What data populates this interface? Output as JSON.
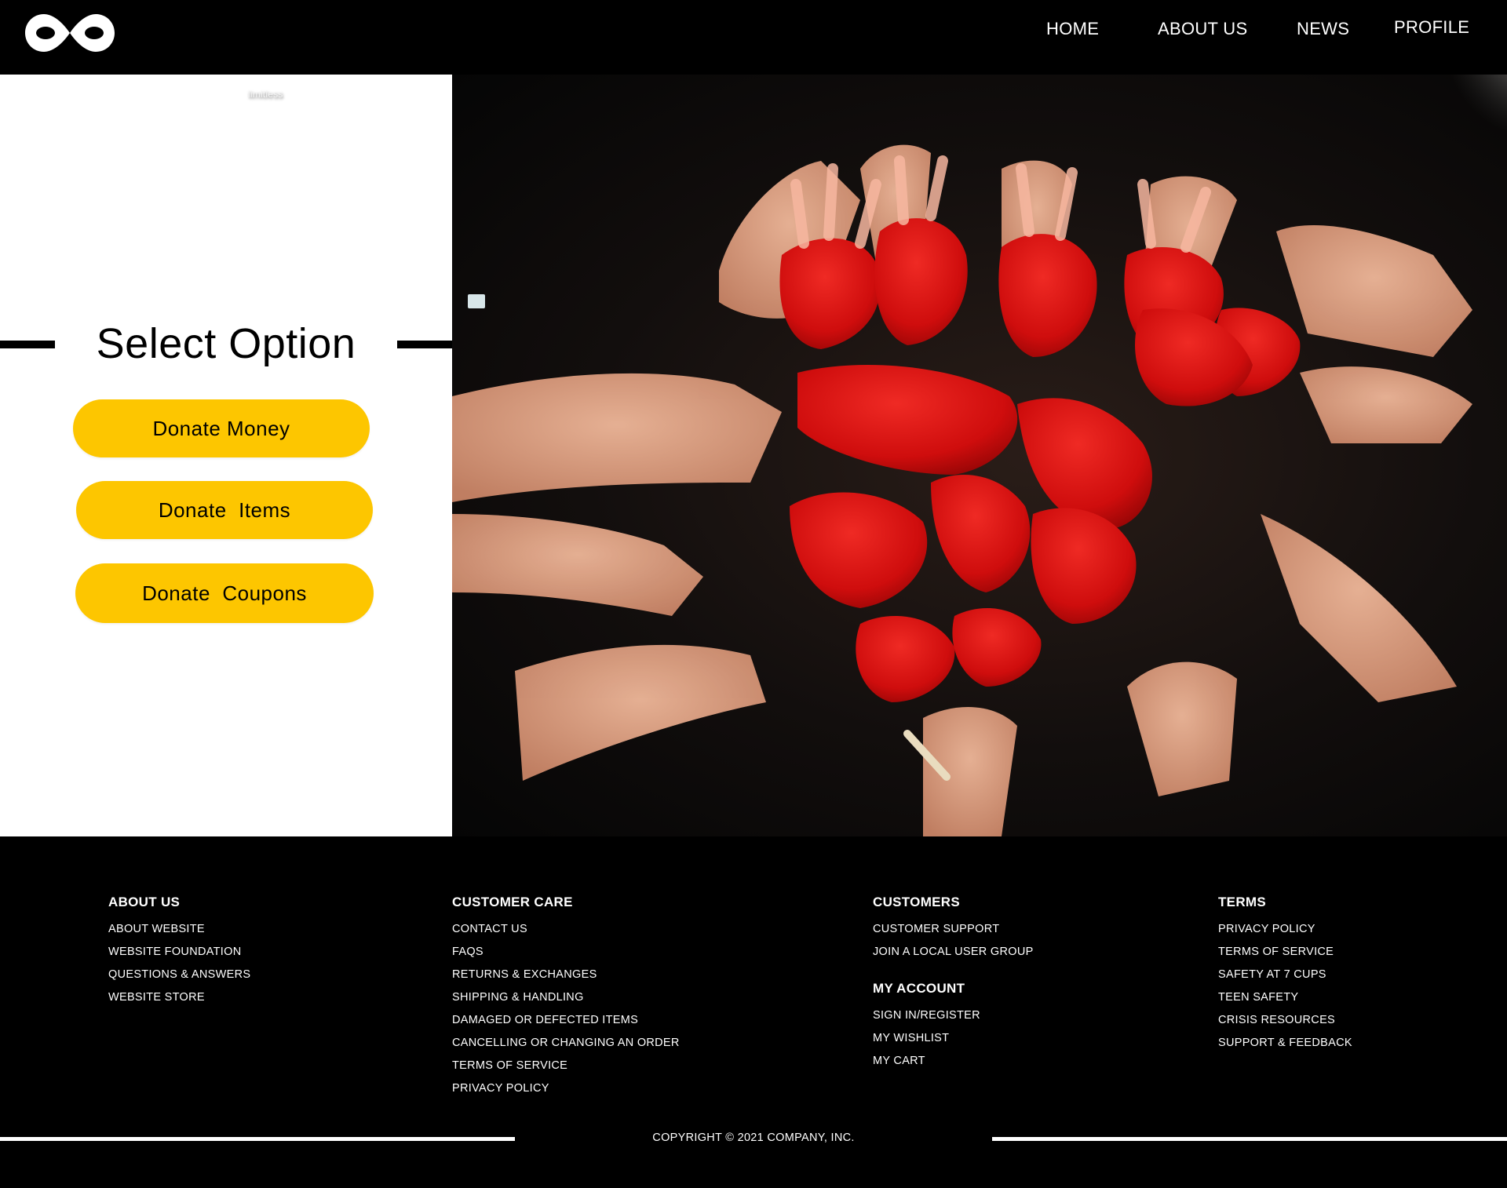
{
  "header": {
    "logo_icon": "infinity-logo-icon",
    "nav": [
      {
        "label": "HOME"
      },
      {
        "label": "ABOUT US"
      },
      {
        "label": "NEWS"
      },
      {
        "label": "PROFILE"
      }
    ]
  },
  "left_panel": {
    "brand_text": "limitless",
    "title": "Select Option",
    "options": [
      {
        "label": "Donate Money"
      },
      {
        "label": "Donate  Items"
      },
      {
        "label": "Donate  Coupons"
      }
    ],
    "accent_color": "#fdc600"
  },
  "hero": {
    "description_icon": "red-painted-hands-heart-photo"
  },
  "footer": {
    "columns": [
      {
        "heading": "ABOUT US",
        "links": [
          "ABOUT WEBSITE",
          "WEBSITE FOUNDATION",
          "QUESTIONS & ANSWERS",
          "WEBSITE STORE"
        ]
      },
      {
        "heading": "CUSTOMER CARE",
        "links": [
          "CONTACT US",
          "FAQS",
          "RETURNS & EXCHANGES",
          "SHIPPING & HANDLING",
          "DAMAGED OR DEFECTED ITEMS",
          "CANCELLING OR CHANGING AN ORDER",
          "TERMS OF SERVICE",
          "PRIVACY POLICY"
        ]
      },
      {
        "heading": "CUSTOMERS",
        "links": [
          "CUSTOMER SUPPORT",
          "JOIN A LOCAL USER GROUP"
        ],
        "sub_heading": "MY ACCOUNT",
        "sub_links": [
          "SIGN IN/REGISTER",
          "MY WISHLIST",
          "MY CART"
        ]
      },
      {
        "heading": "TERMS",
        "links": [
          "PRIVACY POLICY",
          "TERMS OF SERVICE",
          "SAFETY AT 7 CUPS",
          "TEEN SAFETY",
          "CRISIS RESOURCES",
          "SUPPORT & FEEDBACK"
        ]
      }
    ],
    "copyright": "COPYRIGHT © 2021 COMPANY, INC."
  }
}
